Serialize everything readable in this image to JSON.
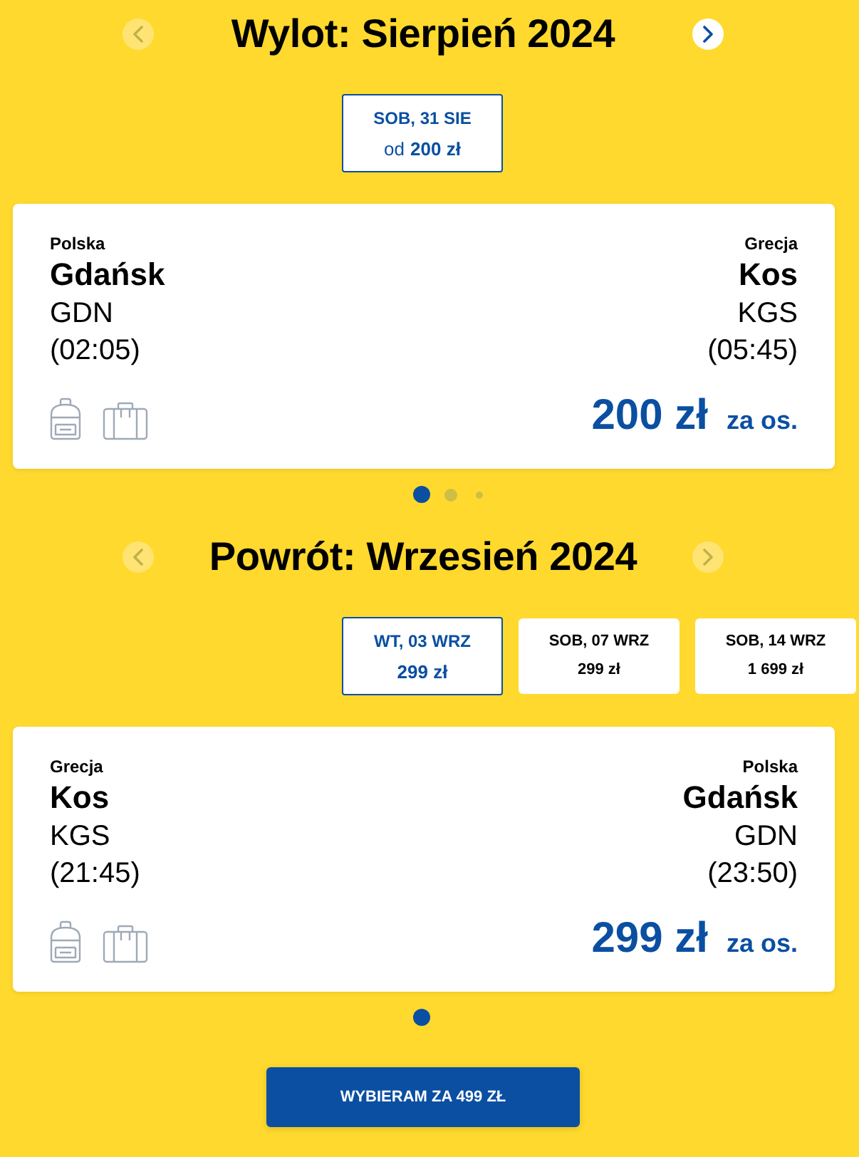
{
  "legs": [
    {
      "title": "Wylot: Sierpień 2024",
      "prev_arrow": {
        "disabled": true
      },
      "next_arrow": {
        "disabled": false
      },
      "dates": [
        {
          "day": "SOB, 31 SIE",
          "prefix": "od",
          "price": "200 zł",
          "selected": true
        }
      ],
      "flight": {
        "from": {
          "country": "Polska",
          "city": "Gdańsk",
          "code": "GDN",
          "time": "(02:05)"
        },
        "to": {
          "country": "Grecja",
          "city": "Kos",
          "code": "KGS",
          "time": "(05:45)"
        },
        "price": "200 zł",
        "per_person": "za os."
      },
      "pager": [
        {
          "selected": true
        },
        {
          "selected": false
        },
        {
          "selected": false
        }
      ]
    },
    {
      "title": "Powrót: Wrzesień 2024",
      "prev_arrow": {
        "disabled": true
      },
      "next_arrow": {
        "disabled": true
      },
      "dates": [
        {
          "day": "WT, 03 WRZ",
          "price": "299 zł",
          "selected": true
        },
        {
          "day": "SOB, 07 WRZ",
          "price": "299 zł",
          "selected": false
        },
        {
          "day": "SOB, 14 WRZ",
          "price": "1 699 zł",
          "selected": false
        }
      ],
      "flight": {
        "from": {
          "country": "Grecja",
          "city": "Kos",
          "code": "KGS",
          "time": "(21:45)"
        },
        "to": {
          "country": "Polska",
          "city": "Gdańsk",
          "code": "GDN",
          "time": "(23:50)"
        },
        "price": "299 zł",
        "per_person": "za os."
      },
      "pager": [
        {
          "selected": true
        }
      ]
    }
  ],
  "select_button": {
    "label": "WYBIERAM ZA 499 ZŁ"
  }
}
